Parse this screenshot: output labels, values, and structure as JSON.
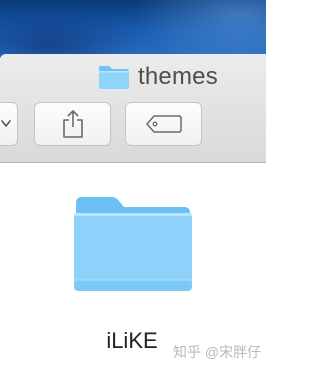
{
  "window": {
    "title": "themes",
    "title_icon": "folder-icon"
  },
  "toolbar": {
    "buttons": [
      {
        "name": "view-options",
        "icon": "chevron-icon"
      },
      {
        "name": "share",
        "icon": "share-icon"
      },
      {
        "name": "tags",
        "icon": "tag-icon"
      }
    ]
  },
  "content": {
    "items": [
      {
        "label": "iLiKE",
        "icon": "folder-icon"
      }
    ]
  },
  "watermark": "知乎 @宋胖仔",
  "colors": {
    "folder_light": "#8fd4fb",
    "folder_dark": "#5cb8ef",
    "titlebar": "#e2e2e2",
    "desktop": "#1a5cb0"
  }
}
